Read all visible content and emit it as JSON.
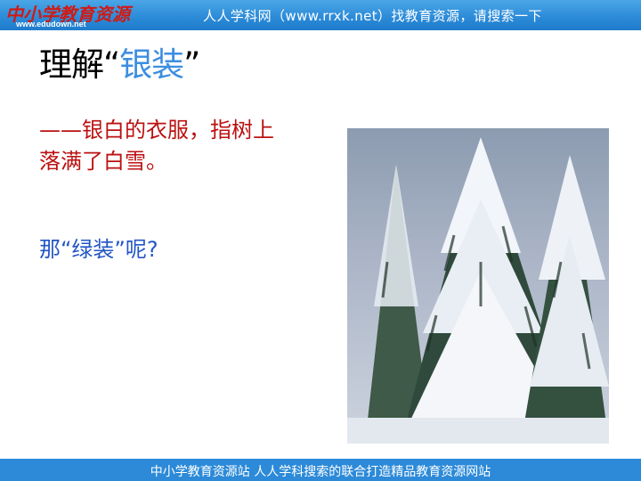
{
  "header": {
    "logo_text": "中小学教育资源",
    "logo_url": "www.edudown.net",
    "banner": "人人学科网（www.rrxk.net）找教育资源，请搜索一下"
  },
  "slide": {
    "title_prefix": "理解",
    "title_quote_open": "“",
    "title_highlight": "银装",
    "title_quote_close": "”",
    "definition": "——银白的衣服，指树上落满了白雪。",
    "question": "那“绿装”呢?"
  },
  "image": {
    "subject": "snow-covered evergreen trees"
  },
  "footer": {
    "text": "中小学教育资源站 人人学科搜索的联合打造精品教育资源网站"
  },
  "colors": {
    "header_blue": "#2b8ad8",
    "title_highlight": "#3d8ee0",
    "definition_red": "#bb1111",
    "question_blue": "#2355c6"
  }
}
